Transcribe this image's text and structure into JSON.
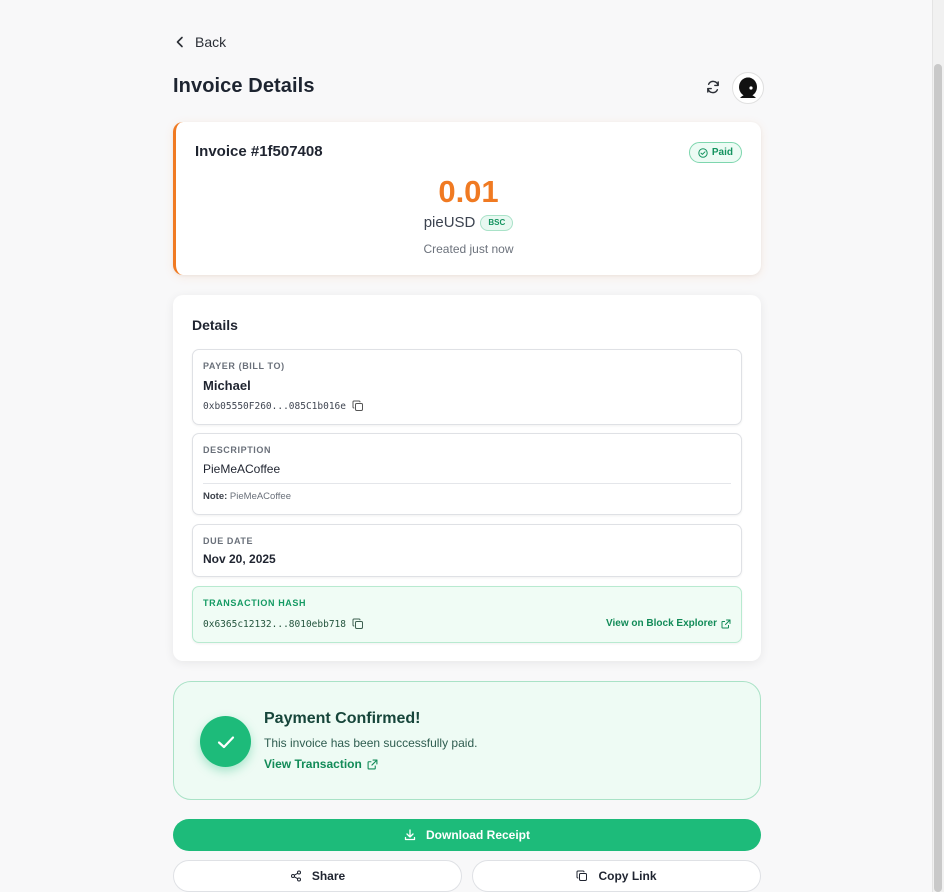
{
  "header": {
    "back_label": "Back",
    "title": "Invoice Details",
    "refresh_icon": "refresh-icon",
    "avatar_icon": "user-avatar"
  },
  "invoice": {
    "number": "Invoice #1f507408",
    "status": "Paid",
    "amount": "0.01",
    "currency": "pieUSD",
    "chain": "BSC",
    "created": "Created just now",
    "accent_color": "#f07a22"
  },
  "details": {
    "title": "Details",
    "payer": {
      "label": "PAYER (BILL TO)",
      "name": "Michael",
      "address": "0xb05550F260...085C1b016e"
    },
    "description": {
      "label": "DESCRIPTION",
      "text": "PieMeACoffee",
      "note_label": "Note:",
      "note_text": "PieMeACoffee"
    },
    "due_date": {
      "label": "DUE DATE",
      "value": "Nov 20, 2025"
    },
    "transaction": {
      "label": "TRANSACTION HASH",
      "hash": "0x6365c12132...8010ebb718",
      "explorer_link": "View on Block Explorer"
    }
  },
  "confirmation": {
    "title": "Payment Confirmed!",
    "subtitle": "This invoice has been successfully paid.",
    "link": "View Transaction",
    "color": "#1dbb7a"
  },
  "actions": {
    "download": "Download Receipt",
    "share": "Share",
    "copy_link": "Copy Link"
  }
}
